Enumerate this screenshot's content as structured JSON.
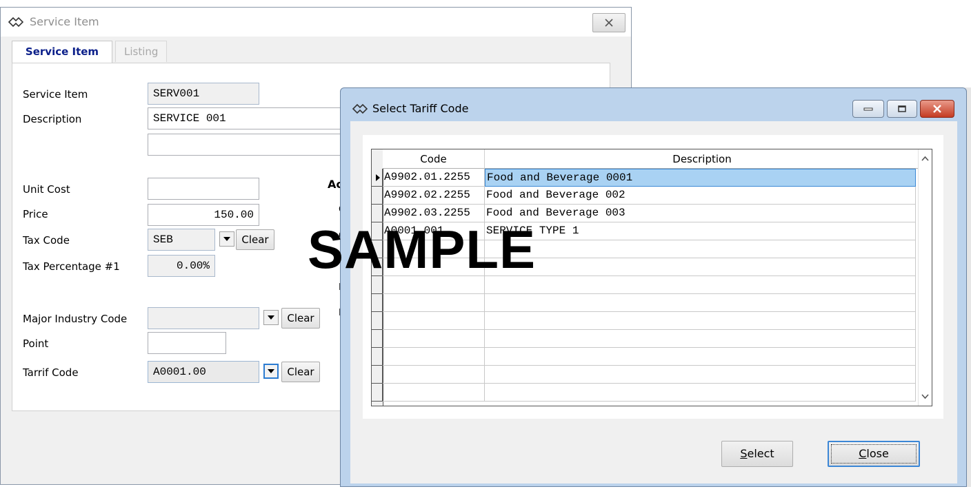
{
  "main_window": {
    "title": "Service Item",
    "tabs": [
      {
        "label": "Service Item",
        "active": true
      },
      {
        "label": "Listing",
        "active": false
      }
    ],
    "form": {
      "service_item_label": "Service Item",
      "service_item_value": "SERV001",
      "description_label": "Description",
      "description_value": "SERVICE 001",
      "description_value_2": "",
      "unit_cost_label": "Unit Cost",
      "unit_cost_value": "",
      "price_label": "Price",
      "price_value": "150.00",
      "tax_code_label": "Tax Code",
      "tax_code_value": "SEB",
      "tax_percentage_label": "Tax Percentage #1",
      "tax_percentage_value": "0.00%",
      "major_industry_label": "Major Industry Code",
      "major_industry_value": "",
      "point_label": "Point",
      "point_value": "",
      "tariff_code_label": "Tarrif Code",
      "tariff_code_value": "A0001.00",
      "clear_label": "Clear"
    },
    "obscured_fragments": [
      "Ac",
      "C",
      "C",
      "F",
      "F"
    ]
  },
  "dialog": {
    "title": "Select Tariff Code",
    "grid": {
      "columns": [
        "Code",
        "Description"
      ],
      "rows": [
        {
          "code": "A9902.01.2255",
          "description": "Food and Beverage 0001",
          "selected": true
        },
        {
          "code": "A9902.02.2255",
          "description": "Food and Beverage 002",
          "selected": false
        },
        {
          "code": "A9902.03.2255",
          "description": "Food and Beverage 003",
          "selected": false
        },
        {
          "code": "A0001.001",
          "description": "SERVICE TYPE 1",
          "selected": false
        }
      ],
      "empty_rows": 9
    },
    "buttons": {
      "select_label": "Select",
      "select_mnemonic": "S",
      "select_rest": "elect",
      "close_label": "Close",
      "close_mnemonic": "C",
      "close_rest": "lose"
    }
  },
  "watermark": "SAMPLE",
  "colors": {
    "tab_active_text": "#0b1f8a",
    "dialog_frame": "#bcd3ec",
    "selection": "#a9d2f3",
    "close_button": "#c43b22"
  }
}
